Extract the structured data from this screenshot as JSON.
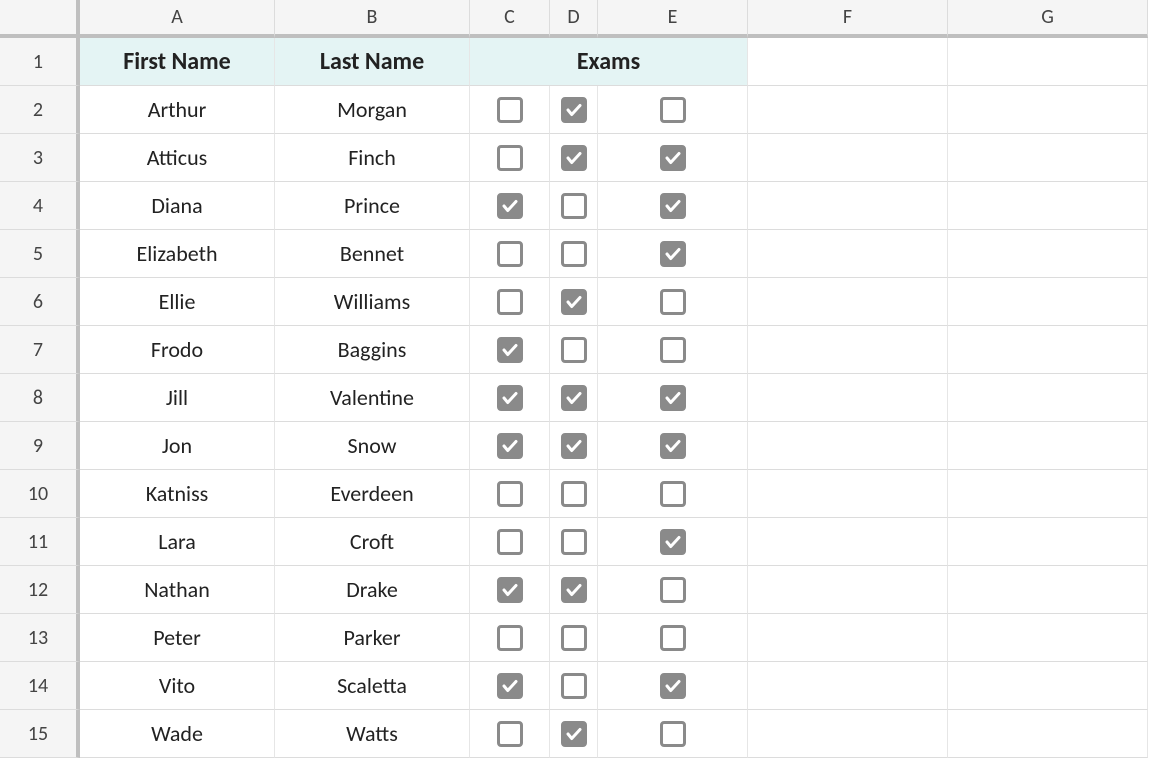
{
  "columns": [
    "A",
    "B",
    "C",
    "D",
    "E",
    "F",
    "G"
  ],
  "headers": {
    "first_name": "First Name",
    "last_name": "Last Name",
    "exams": "Exams"
  },
  "rows": [
    {
      "n": "1"
    },
    {
      "n": "2",
      "first": "Arthur",
      "last": "Morgan",
      "c": false,
      "d": true,
      "e": false
    },
    {
      "n": "3",
      "first": "Atticus",
      "last": "Finch",
      "c": false,
      "d": true,
      "e": true
    },
    {
      "n": "4",
      "first": "Diana",
      "last": "Prince",
      "c": true,
      "d": false,
      "e": true
    },
    {
      "n": "5",
      "first": "Elizabeth",
      "last": "Bennet",
      "c": false,
      "d": false,
      "e": true
    },
    {
      "n": "6",
      "first": "Ellie",
      "last": "Williams",
      "c": false,
      "d": true,
      "e": false
    },
    {
      "n": "7",
      "first": "Frodo",
      "last": "Baggins",
      "c": true,
      "d": false,
      "e": false
    },
    {
      "n": "8",
      "first": "Jill",
      "last": "Valentine",
      "c": true,
      "d": true,
      "e": true
    },
    {
      "n": "9",
      "first": "Jon",
      "last": "Snow",
      "c": true,
      "d": true,
      "e": true
    },
    {
      "n": "10",
      "first": "Katniss",
      "last": "Everdeen",
      "c": false,
      "d": false,
      "e": false
    },
    {
      "n": "11",
      "first": "Lara",
      "last": "Croft",
      "c": false,
      "d": false,
      "e": true
    },
    {
      "n": "12",
      "first": "Nathan",
      "last": "Drake",
      "c": true,
      "d": true,
      "e": false
    },
    {
      "n": "13",
      "first": "Peter",
      "last": "Parker",
      "c": false,
      "d": false,
      "e": false
    },
    {
      "n": "14",
      "first": "Vito",
      "last": "Scaletta",
      "c": true,
      "d": false,
      "e": true
    },
    {
      "n": "15",
      "first": "Wade",
      "last": "Watts",
      "c": false,
      "d": true,
      "e": false
    }
  ]
}
